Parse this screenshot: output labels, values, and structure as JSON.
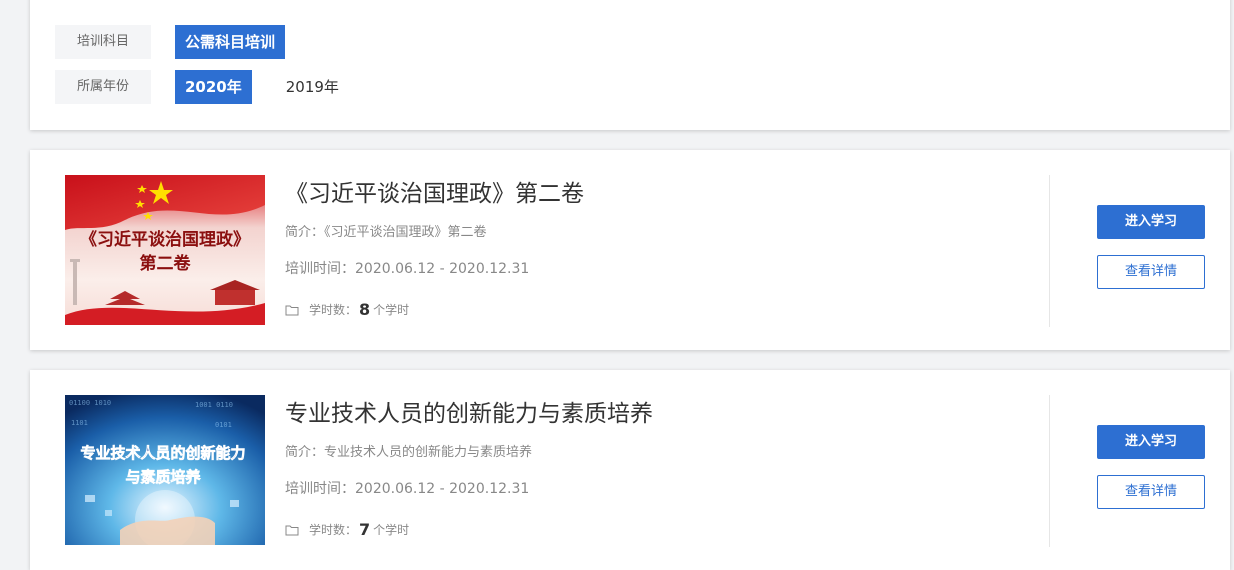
{
  "filters": {
    "subject": {
      "label": "培训科目",
      "options": [
        {
          "text": "公需科目培训",
          "active": true
        }
      ]
    },
    "year": {
      "label": "所属年份",
      "options": [
        {
          "text": "2020年",
          "active": true
        },
        {
          "text": "2019年",
          "active": false
        }
      ]
    }
  },
  "courses": [
    {
      "title": "《习近平谈治国理政》第二卷",
      "desc": "简介：《习近平谈治国理政》第二卷",
      "time": "培训时间：2020.06.12 - 2020.12.31",
      "hours_label": "学时数：",
      "hours_value": "8",
      "hours_unit": "个学时",
      "thumb_text_line1": "《习近平谈治国理政》",
      "thumb_text_line2": "第二卷",
      "enter_label": "进入学习",
      "detail_label": "查看详情"
    },
    {
      "title": "专业技术人员的创新能力与素质培养",
      "desc": "简介：专业技术人员的创新能力与素质培养",
      "time": "培训时间：2020.06.12 - 2020.12.31",
      "hours_label": "学时数：",
      "hours_value": "7",
      "hours_unit": "个学时",
      "thumb_text_line1": "专业技术人员的创新能力",
      "thumb_text_line2": "与素质培养",
      "enter_label": "进入学习",
      "detail_label": "查看详情"
    }
  ],
  "colors": {
    "accent": "#2d6fd2",
    "label_bg": "#f4f5f7"
  },
  "icons": {
    "hours": "folder-icon"
  }
}
